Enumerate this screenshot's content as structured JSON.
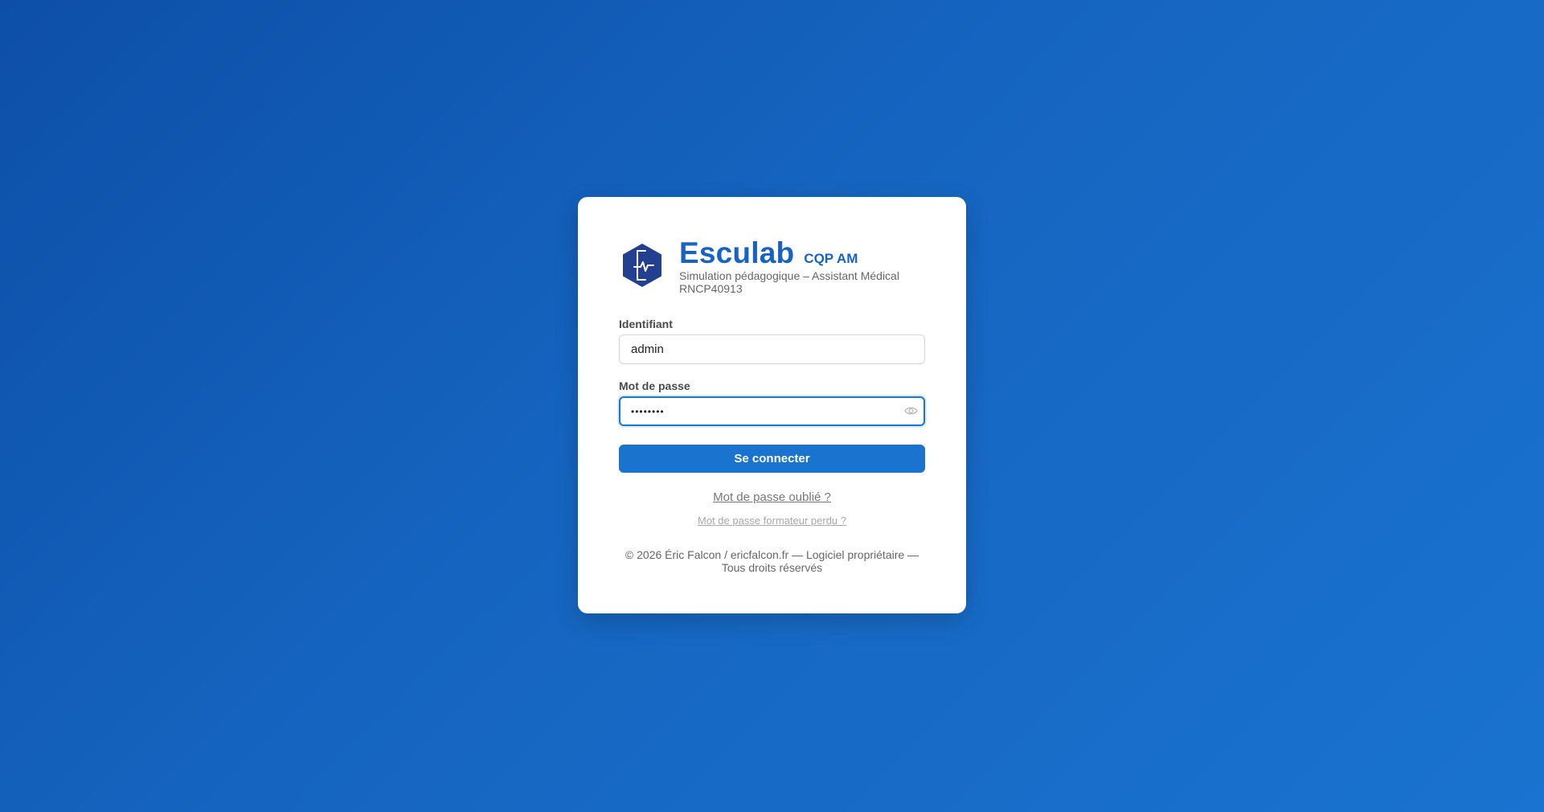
{
  "brand": {
    "title": "Esculab",
    "tag": "CQP AM",
    "subtitle": "Simulation pédagogique – Assistant Médical RNCP40913",
    "logo_icon": "heartbeat-hexagon-icon",
    "color": "#1862c4"
  },
  "form": {
    "username_label": "Identifiant",
    "username_value": "admin",
    "password_label": "Mot de passe",
    "password_value": "••••••••",
    "password_toggle_icon": "eye-icon",
    "submit_label": "Se connecter",
    "accent": "#1a73cf"
  },
  "links": {
    "forgot_password": "Mot de passe oublié ?",
    "trainer_password": "Mot de passe formateur perdu ?"
  },
  "footer": {
    "text": "© 2026 Éric Falcon / ericfalcon.fr — Logiciel propriétaire — Tous droits réservés"
  },
  "background": {
    "gradient_from": "#0d4fa8",
    "gradient_to": "#1a73d0"
  }
}
